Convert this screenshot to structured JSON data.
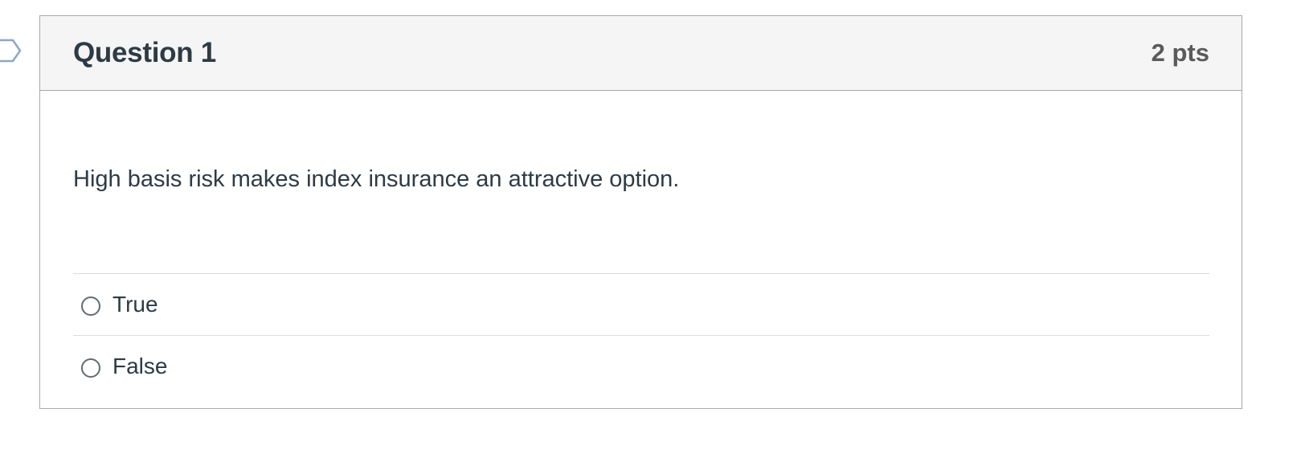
{
  "question": {
    "title": "Question 1",
    "points": "2 pts",
    "text": "High basis risk makes index insurance an attractive option.",
    "answers": [
      {
        "label": "True",
        "selected": false
      },
      {
        "label": "False",
        "selected": false
      }
    ]
  },
  "colors": {
    "header_bg": "#f5f5f5",
    "border": "#a8a8a8",
    "text": "#2d3b45",
    "points_text": "#5a5a5a",
    "divider": "#dcdcdc"
  },
  "icons": {
    "flag": "flag-question-icon",
    "radio": "radio-unchecked-icon"
  }
}
